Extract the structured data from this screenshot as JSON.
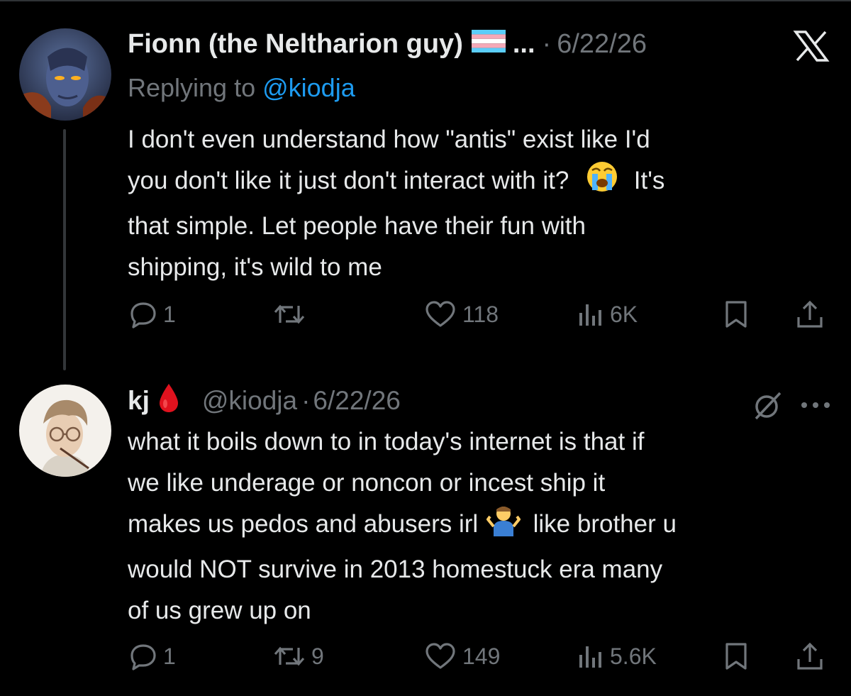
{
  "tweet1": {
    "display_name": "Fionn (the Neltharion guy)",
    "flag_icon": "transgender-flag-icon",
    "truncation": "...",
    "separator": "·",
    "date": "6/22/26",
    "platform_icon": "x-logo-icon",
    "replying_prefix": "Replying to",
    "replying_handle": "@kiodja",
    "body_lines": [
      "I don't even understand how \"antis\" exist like I'd",
      "you don't like it just don't interact with it?",
      "It's",
      "that simple. Let people have their fun with",
      "shipping, it's wild to me"
    ],
    "emoji": "loudly-crying-face-emoji",
    "actions": {
      "replies": "1",
      "retweets": "",
      "likes": "118",
      "views": "6K"
    }
  },
  "tweet2": {
    "display_name": "kj",
    "name_emoji": "blood-drop-emoji",
    "handle": "@kiodja",
    "separator": "·",
    "date": "6/22/26",
    "body_lines": [
      "what it boils down to in today's internet is that if",
      "we like underage or noncon or incest ship it",
      "makes us pedos and abusers irl",
      "like brother u",
      "would NOT survive in 2013 homestuck era many",
      "of us grew up on"
    ],
    "emoji": "man-shrugging-emoji",
    "actions": {
      "replies": "1",
      "retweets": "9",
      "likes": "149",
      "views": "5.6K"
    }
  },
  "colors": {
    "background": "#000000",
    "text": "#e7e9ea",
    "muted": "#71767b",
    "link": "#1d9bf0"
  }
}
